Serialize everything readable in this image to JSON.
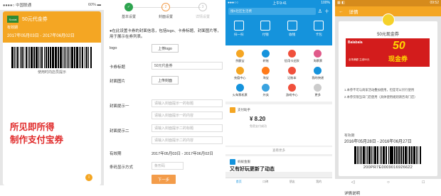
{
  "panel1": {
    "status_left": "●●●●○ 中国联通",
    "status_right": "60% ▬",
    "logo_text": "Social",
    "card_name": "50元代金券",
    "valid_label": "有效期",
    "valid_dates": "2017年05月03日 - 2017年06月02日",
    "barcode_tip": "使用时向店员提示",
    "tagline1": "所见即所得",
    "tagline2": "制作支付宝券"
  },
  "panel2": {
    "steps": [
      {
        "num": "✓",
        "label": "基本设置",
        "state": "done"
      },
      {
        "num": "2",
        "label": "封面设置",
        "state": "current"
      },
      {
        "num": "3",
        "label": "详情设置",
        "state": "todo"
      }
    ],
    "info": "●在此设置卡券的封面信息，包括logo、卡券标题、封面图片等，用于展示在券列表。",
    "logo_label": "logo",
    "logo_btn": "上传logo",
    "title_label": "卡券标题",
    "title_value": "50元代金券",
    "cover_label": "封面图片",
    "cover_btn": "上传封面",
    "tip1_label": "封面提示一",
    "tip1_title_ph": "请输入封面提示一的标题",
    "tip1_content_ph": "请输入封面提示一的内容",
    "tip2_label": "封面提示二",
    "tip2_title_ph": "请输入封面提示二的标题",
    "tip2_content_ph": "请输入封面提示二的内容",
    "valid_label": "有效期",
    "valid_value": "2017年05月03日 - 2017年06月02日",
    "show_label": "条码显示方式",
    "show_value": "条形码",
    "next_btn": "下一步"
  },
  "panel3": {
    "status_left": "●●●○○",
    "status_time": "上午9:41",
    "status_right": "100%",
    "search_ph": "搜K社区生活费",
    "top_actions": [
      "扫一扫",
      "付钱",
      "收钱",
      "卡包"
    ],
    "grid": [
      {
        "label": "余额宝",
        "color": "#f5a623"
      },
      {
        "label": "转账",
        "color": "#1593dc"
      },
      {
        "label": "信用卡还款",
        "color": "#f0503c"
      },
      {
        "label": "淘票票",
        "color": "#e05a8a"
      },
      {
        "label": "充值中心",
        "color": "#f5a623"
      },
      {
        "label": "淘宝",
        "color": "#ff7a19"
      },
      {
        "label": "记账本",
        "color": "#f0503c"
      },
      {
        "label": "我的快递",
        "color": "#1593dc"
      },
      {
        "label": "火车票机票",
        "color": "#1593dc"
      },
      {
        "label": "外卖",
        "color": "#3aa3e0"
      },
      {
        "label": "游戏中心",
        "color": "#f0503c"
      },
      {
        "label": "更多",
        "color": "#cccccc"
      }
    ],
    "msg_source": "支付助手",
    "msg_amount": "¥ 8.20",
    "msg_sub": "免密支付成功",
    "more": "查看更多",
    "msg2_source": "蚂蚁金服",
    "msg2_title": "又有好玩更新了动态",
    "tabs": [
      "首页",
      "口碑",
      "朋友",
      "我的"
    ]
  },
  "panel4": {
    "status_left": "▦ ◧",
    "status_right": "09:52",
    "nav_back": "←",
    "nav_title": "详情",
    "card_title": "50元现金券",
    "banner_brand": "Balabala",
    "banner_num": "50",
    "banner_coupon": "现金券",
    "banner_sub": "全场满额 立减50元",
    "rule1": "1.本券不可与商家活动叠加使用，但是可以另行使用",
    "rule2": "2.本券仅限当日门店使用（具体使用规则请咨询门店）",
    "valid_label": "有效期",
    "valid_value": "2016年05月28日 - 2016年06月27日",
    "code": "200PR7E0009016926622",
    "detail": "详情说明"
  }
}
